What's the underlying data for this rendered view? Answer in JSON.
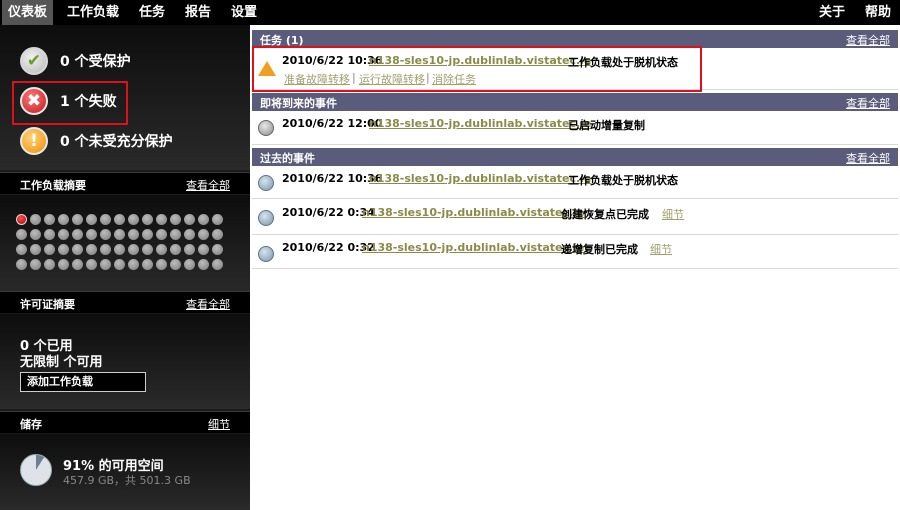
{
  "topnav": {
    "items": [
      {
        "label": "仪表板"
      },
      {
        "label": "工作负载"
      },
      {
        "label": "任务"
      },
      {
        "label": "报告"
      },
      {
        "label": "设置"
      }
    ],
    "right": [
      {
        "label": "关于"
      },
      {
        "label": "帮助"
      }
    ],
    "active_index": 0
  },
  "status": {
    "protected": "0 个受保护",
    "failed": "1 个失败",
    "underprotected": "0 个未受充分保护",
    "ok_glyph": "✔",
    "fail_glyph": "✖",
    "warn_glyph": "!"
  },
  "workload_summary": {
    "title": "工作负载摘要",
    "view_all": "查看全部",
    "total": 60,
    "failed_count": 1
  },
  "license_summary": {
    "title": "许可证摘要",
    "view_all": "查看全部",
    "used": "0 个已用",
    "available": "无限制 个可用",
    "add_button": "添加工作负载"
  },
  "storage": {
    "title": "储存",
    "details_link": "细节",
    "free_percent": 91,
    "free_text": "91% 的可用空间",
    "size_text": "457.9 GB，共 501.3 GB"
  },
  "tasks": {
    "title": "任务 (1)",
    "view_all": "查看全部",
    "items": [
      {
        "timestamp": "2010/6/22 10:36",
        "host": "n138-sles10-jp.dublinlab.vistatec.ie",
        "message": "工作负载处于脱机状态",
        "actions": [
          "准备故障转移",
          "运行故障转移",
          "消除任务"
        ]
      }
    ]
  },
  "upcoming": {
    "title": "即将到来的事件",
    "view_all": "查看全部",
    "items": [
      {
        "timestamp": "2010/6/22 12:00",
        "host": "n138-sles10-jp.dublinlab.vistatec.ie",
        "message": "已启动增量复制"
      }
    ]
  },
  "past": {
    "title": "过去的事件",
    "view_all": "查看全部",
    "items": [
      {
        "timestamp": "2010/6/22 10:36",
        "host": "n138-sles10-jp.dublinlab.vistatec.ie",
        "message": "工作负载处于脱机状态",
        "link": ""
      },
      {
        "timestamp": "2010/6/22 0:34",
        "host": "n138-sles10-jp.dublinlab.vistatec.ie",
        "message": "创建恢复点已完成",
        "link": "细节"
      },
      {
        "timestamp": "2010/6/22 0:32",
        "host": "n138-sles10-jp.dublinlab.vistatec.ie",
        "message": "递增复制已完成",
        "link": "细节"
      }
    ]
  }
}
